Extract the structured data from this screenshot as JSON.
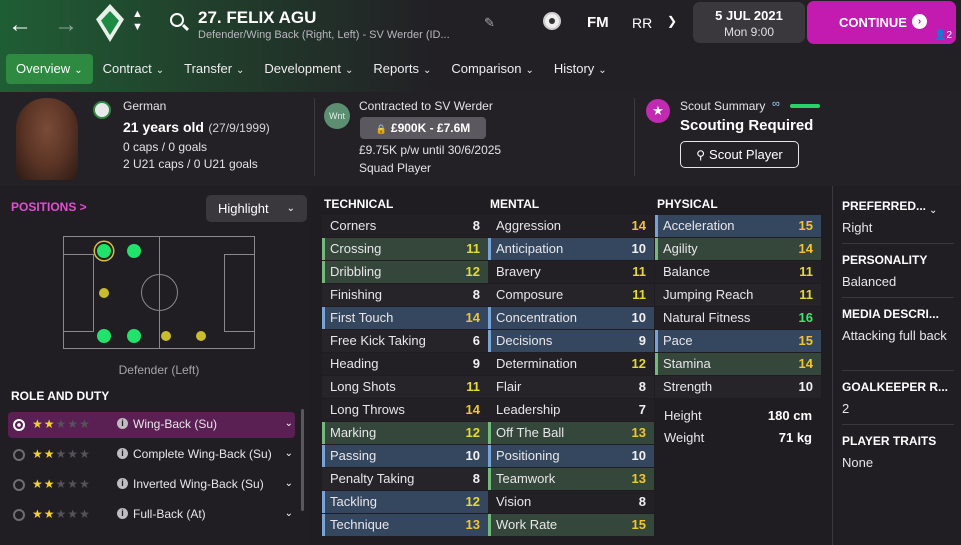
{
  "header": {
    "player_name": "27. FELIX AGU",
    "player_subtitle": "Defender/Wing Back (Right, Left) - SV Werder (ID...",
    "fm_label": "FM",
    "rr_label": "RR",
    "date": "5 JUL 2021",
    "day_time": "Mon 9:00",
    "continue_label": "CONTINUE",
    "continue_badge": "2"
  },
  "tabs": [
    {
      "label": "Overview"
    },
    {
      "label": "Contract"
    },
    {
      "label": "Transfer"
    },
    {
      "label": "Development"
    },
    {
      "label": "Reports"
    },
    {
      "label": "Comparison"
    },
    {
      "label": "History"
    }
  ],
  "bio": {
    "nationality": "German",
    "age": "21 years old",
    "dob": "(27/9/1999)",
    "caps": "0 caps / 0 goals",
    "u21_caps": "2 U21 caps / 0 U21 goals"
  },
  "contract": {
    "club_badge": "Wnt",
    "title": "Contracted to SV Werder",
    "value_range": "£900K - £7.6M",
    "wage": "£9.75K p/w until 30/6/2025",
    "squad_status": "Squad Player"
  },
  "scout": {
    "title": "Scout Summary",
    "status": "Scouting Required",
    "button": "Scout Player"
  },
  "positions": {
    "title": "POSITIONS >",
    "dropdown": "Highlight",
    "selected_label": "Defender (Left)"
  },
  "roles": {
    "title": "ROLE AND DUTY",
    "items": [
      {
        "name": "Wing-Back (Su)",
        "stars": 2,
        "active": true
      },
      {
        "name": "Complete Wing-Back (Su)",
        "stars": 2,
        "active": false
      },
      {
        "name": "Inverted Wing-Back (Su)",
        "stars": 2,
        "active": false
      },
      {
        "name": "Full-Back (At)",
        "stars": 2,
        "active": false
      }
    ]
  },
  "technical": {
    "title": "TECHNICAL",
    "attrs": [
      {
        "name": "Corners",
        "value": "8",
        "hl": ""
      },
      {
        "name": "Crossing",
        "value": "11",
        "hl": "green"
      },
      {
        "name": "Dribbling",
        "value": "12",
        "hl": "green"
      },
      {
        "name": "Finishing",
        "value": "8",
        "hl": ""
      },
      {
        "name": "First Touch",
        "value": "14",
        "hl": "blue"
      },
      {
        "name": "Free Kick Taking",
        "value": "6",
        "hl": ""
      },
      {
        "name": "Heading",
        "value": "9",
        "hl": ""
      },
      {
        "name": "Long Shots",
        "value": "11",
        "hl": ""
      },
      {
        "name": "Long Throws",
        "value": "14",
        "hl": ""
      },
      {
        "name": "Marking",
        "value": "12",
        "hl": "green"
      },
      {
        "name": "Passing",
        "value": "10",
        "hl": "blue"
      },
      {
        "name": "Penalty Taking",
        "value": "8",
        "hl": ""
      },
      {
        "name": "Tackling",
        "value": "12",
        "hl": "blue"
      },
      {
        "name": "Technique",
        "value": "13",
        "hl": "blue"
      }
    ]
  },
  "mental": {
    "title": "MENTAL",
    "attrs": [
      {
        "name": "Aggression",
        "value": "14",
        "hl": ""
      },
      {
        "name": "Anticipation",
        "value": "10",
        "hl": "blue"
      },
      {
        "name": "Bravery",
        "value": "11",
        "hl": ""
      },
      {
        "name": "Composure",
        "value": "11",
        "hl": ""
      },
      {
        "name": "Concentration",
        "value": "10",
        "hl": "blue"
      },
      {
        "name": "Decisions",
        "value": "9",
        "hl": "blue"
      },
      {
        "name": "Determination",
        "value": "12",
        "hl": ""
      },
      {
        "name": "Flair",
        "value": "8",
        "hl": ""
      },
      {
        "name": "Leadership",
        "value": "7",
        "hl": ""
      },
      {
        "name": "Off The Ball",
        "value": "13",
        "hl": "green"
      },
      {
        "name": "Positioning",
        "value": "10",
        "hl": "blue"
      },
      {
        "name": "Teamwork",
        "value": "13",
        "hl": "green"
      },
      {
        "name": "Vision",
        "value": "8",
        "hl": ""
      },
      {
        "name": "Work Rate",
        "value": "15",
        "hl": "green"
      }
    ]
  },
  "physical": {
    "title": "PHYSICAL",
    "attrs": [
      {
        "name": "Acceleration",
        "value": "15",
        "hl": "blue"
      },
      {
        "name": "Agility",
        "value": "14",
        "hl": "green"
      },
      {
        "name": "Balance",
        "value": "11",
        "hl": ""
      },
      {
        "name": "Jumping Reach",
        "value": "11",
        "hl": ""
      },
      {
        "name": "Natural Fitness",
        "value": "16",
        "hl": ""
      },
      {
        "name": "Pace",
        "value": "15",
        "hl": "blue"
      },
      {
        "name": "Stamina",
        "value": "14",
        "hl": "green"
      },
      {
        "name": "Strength",
        "value": "10",
        "hl": ""
      }
    ],
    "height_label": "Height",
    "height": "180 cm",
    "weight_label": "Weight",
    "weight": "71 kg"
  },
  "right": {
    "preferred_foot_title": "PREFERRED...",
    "preferred_foot": "Right",
    "personality_title": "PERSONALITY",
    "personality": "Balanced",
    "media_title": "MEDIA DESCRI...",
    "media": "Attacking full back",
    "gk_title": "GOALKEEPER R...",
    "gk": "2",
    "traits_title": "PLAYER TRAITS",
    "traits": "None"
  }
}
